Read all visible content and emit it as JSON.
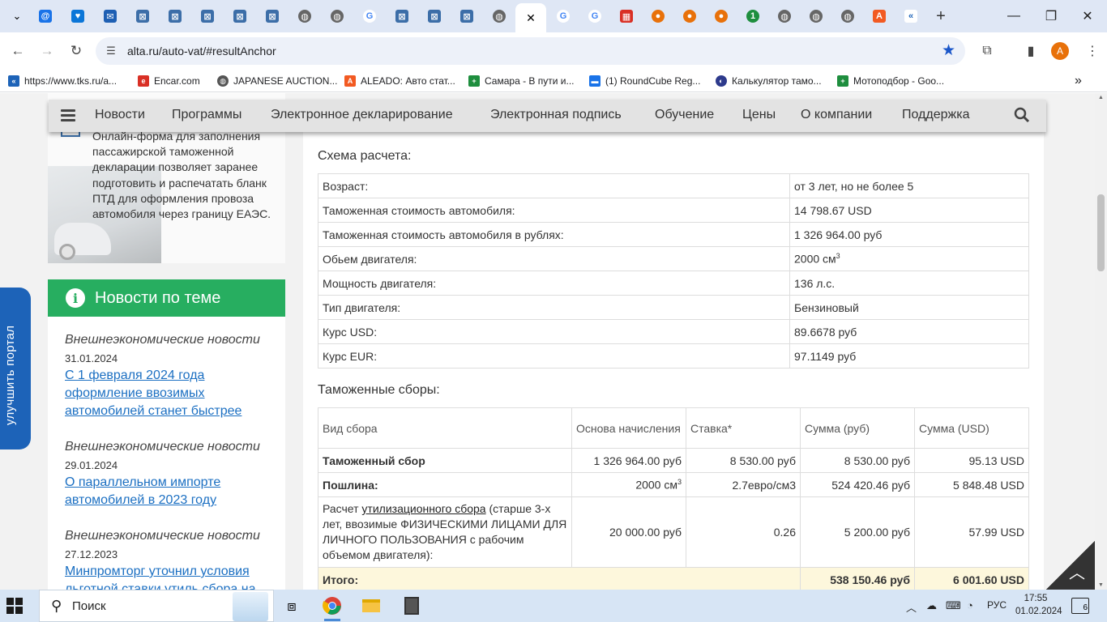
{
  "browser": {
    "url": "alta.ru/auto-vat/#resultAnchor",
    "tabs_count_visible": 27,
    "bookmarks": [
      {
        "label": "https://www.tks.ru/a...",
        "icon": "tks-icon"
      },
      {
        "label": "Encar.com",
        "icon": "encar-icon"
      },
      {
        "label": "JAPANESE AUCTION...",
        "icon": "globe-icon"
      },
      {
        "label": "ALEADO: Авто стат...",
        "icon": "aleado-icon"
      },
      {
        "label": "Самара - В пути и...",
        "icon": "plus-icon"
      },
      {
        "label": "(1) RoundCube Reg...",
        "icon": "roundcube-icon"
      },
      {
        "label": "Калькулятор тамо...",
        "icon": "calc-icon"
      },
      {
        "label": "Мотоподбор - Goo...",
        "icon": "plus-icon"
      }
    ],
    "profile_initial": "A"
  },
  "site_nav": {
    "items": [
      "Новости",
      "Программы",
      "Электронное декларирование",
      "Электронная подпись",
      "Обучение",
      "Цены",
      "О компании",
      "Поддержка"
    ]
  },
  "promo": {
    "text": "Онлайн-форма для заполнения пассажирской таможенной декларации позволяет заранее подготовить и распечатать бланк ПТД для оформления провоза автомобиля через границу ЕАЭС."
  },
  "news": {
    "title": "Новости по теме",
    "items": [
      {
        "category": "Внешнеэкономические новости",
        "date": "31.01.2024",
        "link": "С 1 февраля 2024 года оформление ввозимых автомобилей станет быстрее"
      },
      {
        "category": "Внешнеэкономические новости",
        "date": "29.01.2024",
        "link": "О параллельном импорте автомобилей в 2023 году"
      },
      {
        "category": "Внешнеэкономические новости",
        "date": "27.12.2023",
        "link": "Минпромторг уточнил условия льготной ставки утиль.сбора на"
      }
    ]
  },
  "improve_tab": "улучшить портал",
  "scheme": {
    "title": "Схема расчета:",
    "rows": [
      {
        "key": "Возраст:",
        "value": "от 3 лет, но не более 5"
      },
      {
        "key": "Таможенная стоимость автомобиля:",
        "value": "14 798.67 USD"
      },
      {
        "key": "Таможенная стоимость автомобиля в рублях:",
        "value": "1 326 964.00 руб"
      },
      {
        "key": "Обьем двигателя:",
        "value": "2000 см"
      },
      {
        "key": "Мощность двигателя:",
        "value": "136 л.с."
      },
      {
        "key": "Тип двигателя:",
        "value": "Бензиновый"
      },
      {
        "key": "Курс USD:",
        "value": "89.6678 руб"
      },
      {
        "key": "Курс EUR:",
        "value": "97.1149 руб"
      }
    ],
    "volume_sup": "3"
  },
  "fees": {
    "title": "Таможенные сборы:",
    "headers": [
      "Вид сбора",
      "Основа начисления",
      "Ставка*",
      "Сумма (руб)",
      "Сумма (USD)"
    ],
    "row1": {
      "name": "Таможенный сбор",
      "base": "1 326 964.00 руб",
      "rate": "8 530.00 руб",
      "rub": "8 530.00 руб",
      "usd": "95.13 USD"
    },
    "row2": {
      "name": "Пошлина:",
      "base": "2000 см",
      "base_sup": "3",
      "rate": "2.7евро/см3",
      "rub": "524 420.46 руб",
      "usd": "5 848.48 USD"
    },
    "row3": {
      "name_pre": "Расчет ",
      "name_link": "утилизационного сбора",
      "name_post": " (старше 3-х лет, ввозимые ФИЗИЧЕСКИМИ ЛИЦАМИ ДЛЯ ЛИЧНОГО ПОЛЬЗОВАНИЯ с рабочим объемом двигателя):",
      "base": "20 000.00 руб",
      "rate": "0.26",
      "rub": "5 200.00 руб",
      "usd": "57.99 USD"
    },
    "total": {
      "label": "Итого:",
      "rub": "538 150.46 руб",
      "usd": "6 001.60 USD"
    }
  },
  "taskbar": {
    "search_placeholder": "Поиск",
    "lang": "РУС",
    "time": "17:55",
    "date": "01.02.2024",
    "notifications": "6"
  }
}
